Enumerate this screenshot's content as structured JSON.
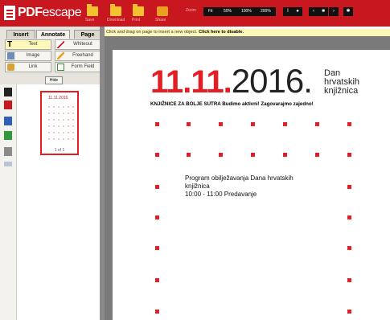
{
  "app": {
    "logo_text_bold": "PDF",
    "logo_text_normal": "escape"
  },
  "toolbar": {
    "icons": [
      {
        "label": "Save",
        "icon": "folder-icon"
      },
      {
        "label": "Download",
        "icon": "folder-icon"
      },
      {
        "label": "Print",
        "icon": "folder-icon"
      },
      {
        "label": "Share",
        "icon": "paint-icon"
      }
    ],
    "zoom_label": "Zoom",
    "zoom_options": [
      "Fit",
      "50%",
      "100%",
      "200%"
    ],
    "accent": "#c8171e"
  },
  "tabs": [
    "Insert",
    "Annotate",
    "Page"
  ],
  "tools": [
    {
      "label": "Text",
      "icon": "text-icon",
      "selected": true
    },
    {
      "label": "Whiteout",
      "icon": "whiteout-icon",
      "selected": false
    },
    {
      "label": "Image",
      "icon": "image-icon",
      "selected": false
    },
    {
      "label": "Freehand",
      "icon": "pencil-icon",
      "selected": false
    },
    {
      "label": "Link",
      "icon": "link-icon",
      "selected": false
    },
    {
      "label": "Form Field",
      "icon": "form-field-icon",
      "selected": false
    }
  ],
  "hide_label": "Hide",
  "thumbnail": {
    "title": "11.11.2016.",
    "page_label": "1 of 1"
  },
  "infobar": {
    "text": "Click and drag on page to insert a new object.",
    "link": "Click here to disable."
  },
  "document": {
    "date_red": "11.11.",
    "date_year": "2016.",
    "dan_line1": "Dan",
    "dan_line2": "hrvatskih",
    "dan_line3": "knjižnica",
    "slogan": "KNJIŽNICE ZA BOLJE SUTRA Budimo aktivni! Zagovarajmo zajedno!",
    "program_line1": "Program obilježavanja Dana hrvatskih",
    "program_line2": "knjižnica",
    "program_line3": "10:00 - 11:00 Predavanje",
    "accent": "#e31e24"
  }
}
